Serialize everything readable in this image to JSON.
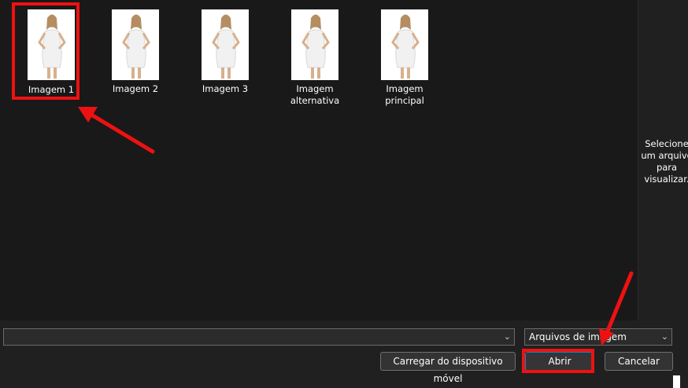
{
  "files": [
    {
      "label": "Imagem 1",
      "selected": true
    },
    {
      "label": "Imagem 2",
      "selected": false
    },
    {
      "label": "Imagem 3",
      "selected": false
    },
    {
      "label": "Imagem alternativa",
      "selected": false
    },
    {
      "label": "Imagem principal",
      "selected": false
    }
  ],
  "preview": {
    "message": "Selecione um arquivo para visualizar."
  },
  "bottom": {
    "filename_value": "",
    "filetype_selected": "Arquivos de imagem",
    "device_button": "Carregar do dispositivo móvel",
    "open_button": "Abrir",
    "cancel_button": "Cancelar"
  },
  "colors": {
    "annotation": "#ee1111",
    "background": "#191919",
    "panel": "#202020"
  },
  "icons": {
    "dropdown": "chevron-down-icon"
  }
}
